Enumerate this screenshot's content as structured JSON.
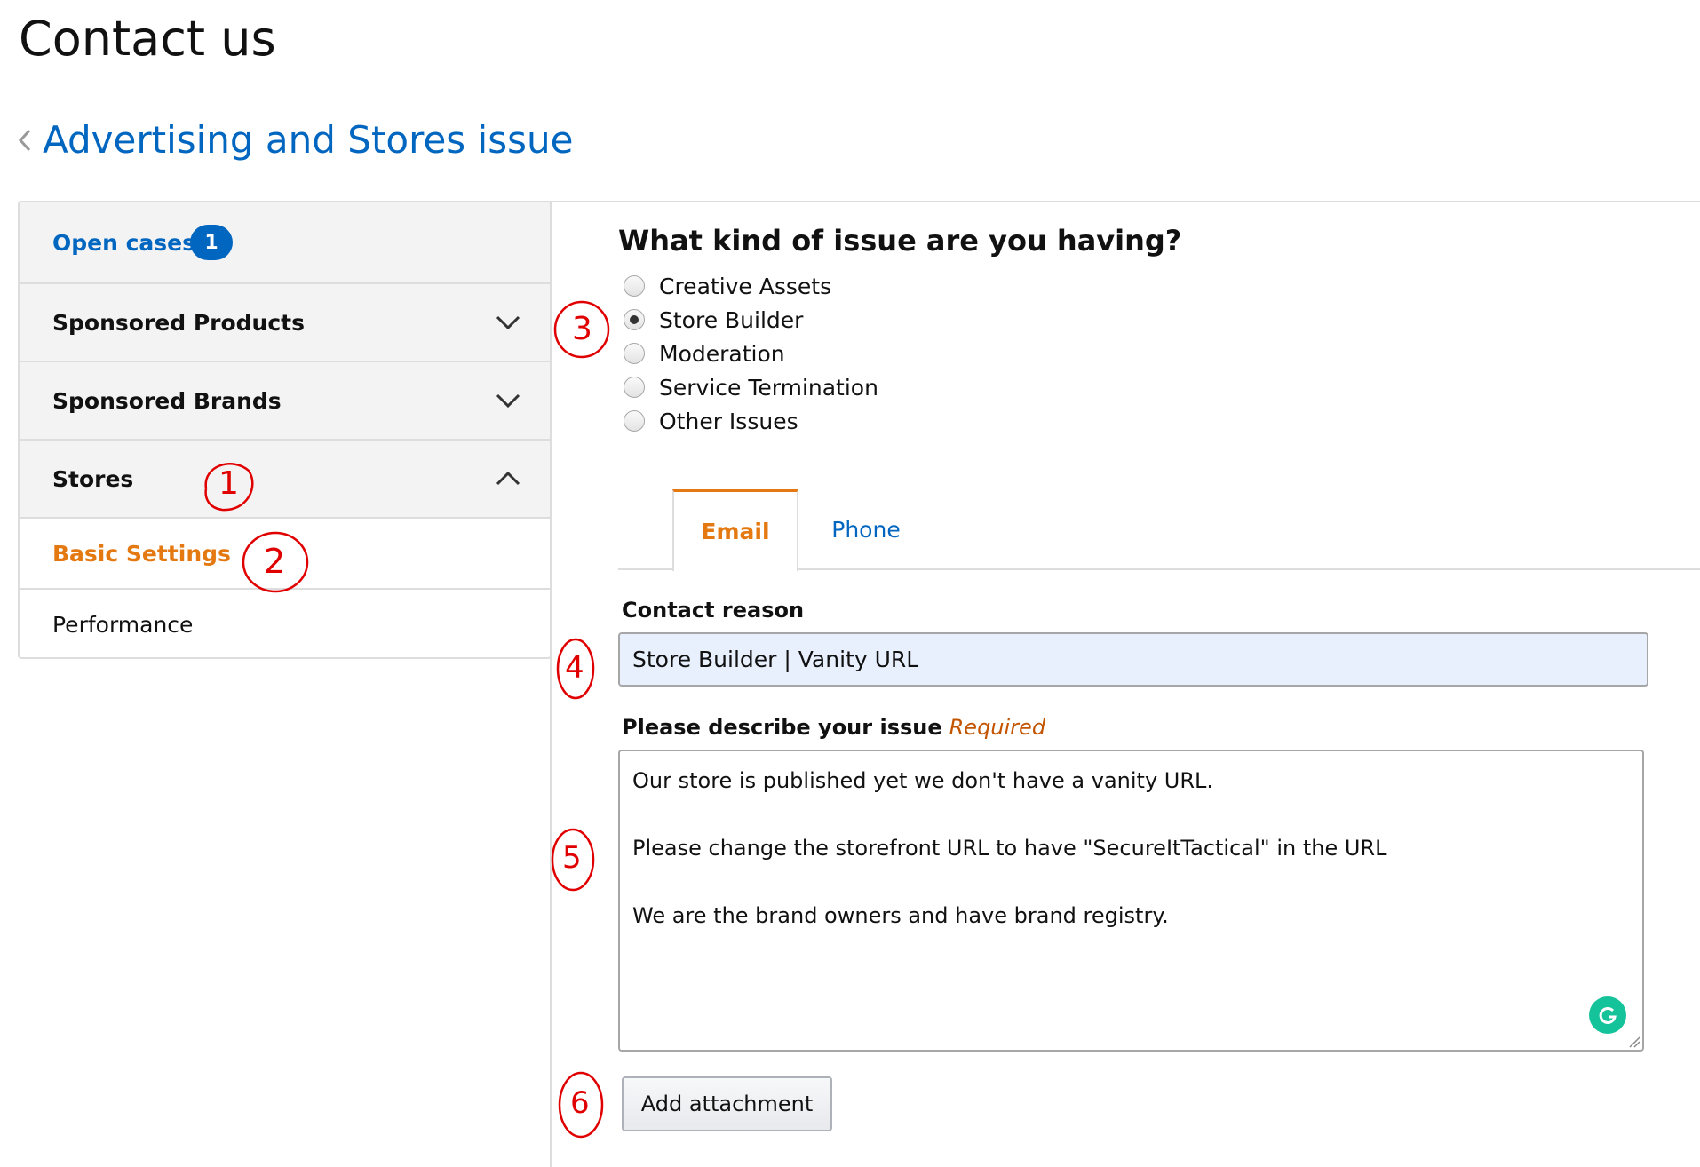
{
  "page": {
    "title": "Contact us"
  },
  "back": {
    "label": "Advertising and Stores issue"
  },
  "sidebar": {
    "open_cases": {
      "label": "Open cases",
      "count": "1"
    },
    "sections": [
      {
        "label": "Sponsored Products",
        "expanded": false
      },
      {
        "label": "Sponsored Brands",
        "expanded": false
      },
      {
        "label": "Stores",
        "expanded": true
      }
    ],
    "stores_items": [
      {
        "label": "Basic Settings",
        "selected": true
      },
      {
        "label": "Performance",
        "selected": false
      }
    ]
  },
  "issue": {
    "question": "What kind of issue are you having?",
    "options": [
      "Creative Assets",
      "Store Builder",
      "Moderation",
      "Service Termination",
      "Other Issues"
    ],
    "selected": "Store Builder"
  },
  "tabs": {
    "email": "Email",
    "phone": "Phone",
    "active": "Email"
  },
  "form": {
    "contact_reason_label": "Contact reason",
    "contact_reason_value": "Store Builder | Vanity URL",
    "describe_label": "Please describe your issue",
    "required_label": "Required",
    "description_lines": [
      "Our store is published yet we don't have a vanity URL.",
      "Please change the storefront URL to have \"SecureItTactical\" in the URL",
      "We are the brand owners and have brand registry."
    ],
    "attach_button": "Add attachment"
  },
  "annotations": [
    "1",
    "2",
    "3",
    "4",
    "5",
    "6"
  ],
  "colors": {
    "link": "#0066c0",
    "accent": "#e47911",
    "required": "#c45500",
    "annotation": "#e00000",
    "autofill": "#e8f0fe",
    "grammarly": "#15c39a"
  }
}
